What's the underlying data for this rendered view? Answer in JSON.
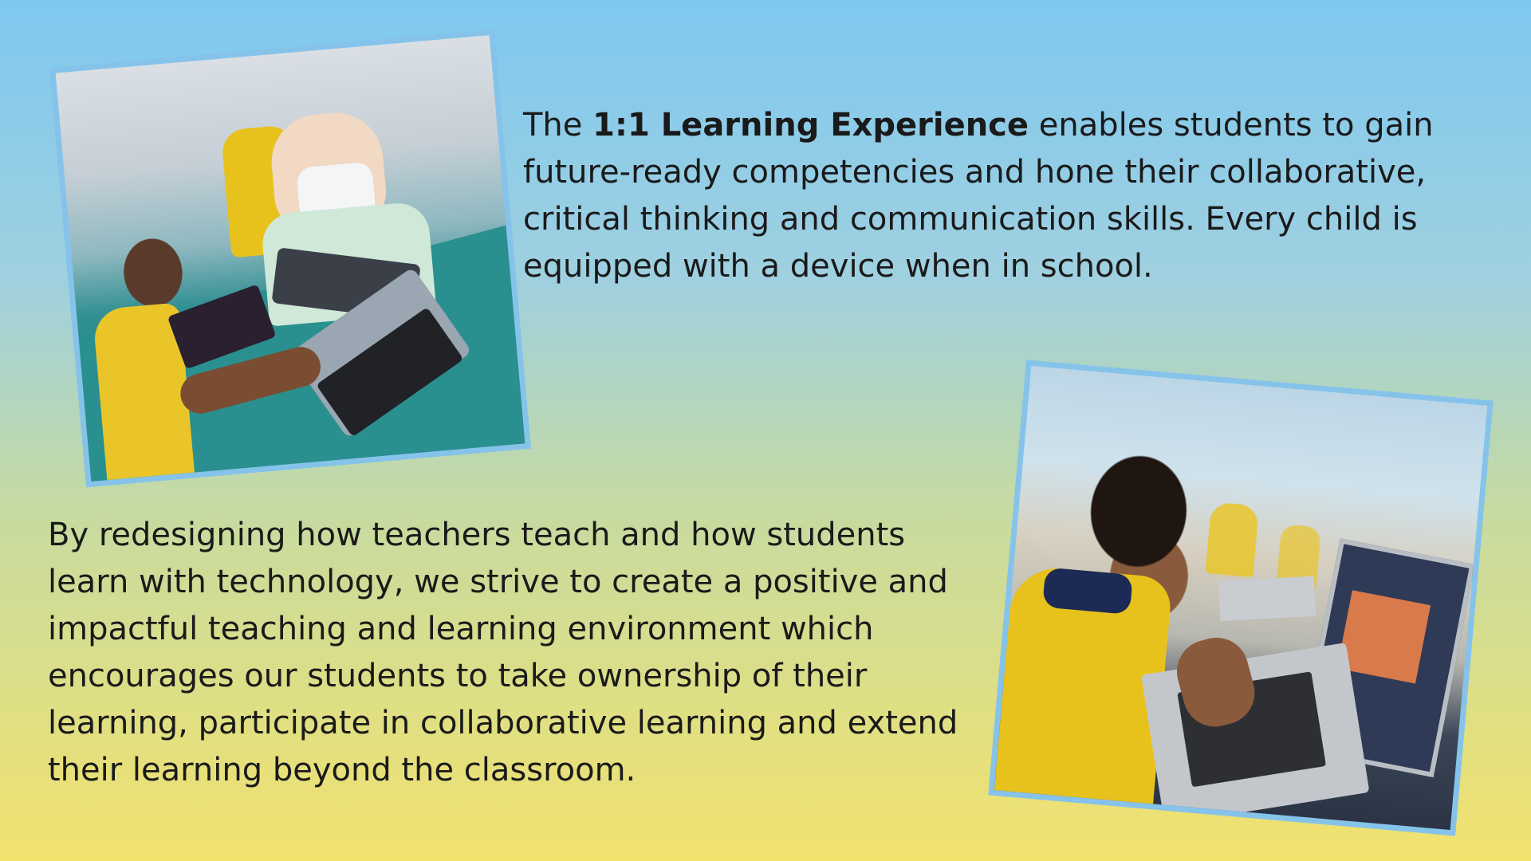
{
  "paragraph_1": {
    "prefix": "The ",
    "highlight": "1:1 Learning Experience",
    "suffix": " enables students to gain future-ready competencies and hone their collaborative, critical thinking and communication skills. Every child is equipped with a device when in school."
  },
  "paragraph_2": {
    "text": "By redesigning how teachers teach and how students learn with technology, we strive to create a positive and impactful teaching and learning environment which encourages our students to take ownership of their learning, participate in collaborative learning and extend their learning beyond the classroom."
  },
  "colors": {
    "background_top": "#7ec8f0",
    "background_bottom": "#f2e26e",
    "photo_border": "#86c3ea",
    "text": "#1a1a1a"
  }
}
